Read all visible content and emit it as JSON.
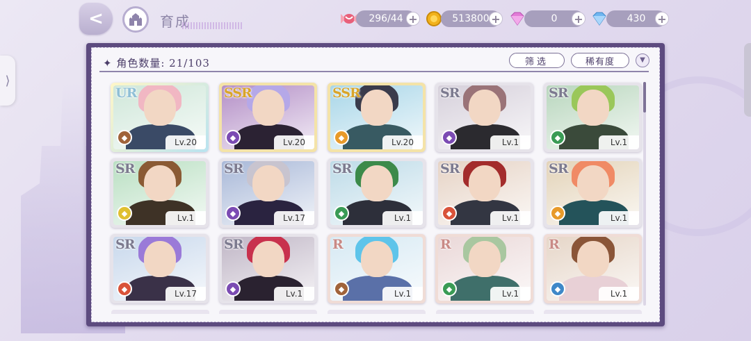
{
  "header": {
    "title": "育成",
    "resources": [
      {
        "name": "candy",
        "value": "296/44",
        "icon": "candy-icon",
        "color": "#e8607a"
      },
      {
        "name": "coin",
        "value": "513800",
        "icon": "coin-icon",
        "color": "#f2b21c"
      },
      {
        "name": "pink-gem",
        "value": "0",
        "icon": "pink-diamond-icon",
        "color": "#e27bd7"
      },
      {
        "name": "blue-gem",
        "value": "430",
        "icon": "blue-diamond-icon",
        "color": "#6fb6f0"
      }
    ],
    "plus_label": "+"
  },
  "panel": {
    "count_label": "✦ 角色数量: 21/103",
    "filter_label": "筛选",
    "rarity_label": "稀有度"
  },
  "characters": [
    {
      "rarity": "UR",
      "level": "Lv.20",
      "role_color": "#a0633a",
      "hair": "#f1b7c3",
      "outfit": "#3a4a66",
      "bg": "#cfe7d9"
    },
    {
      "rarity": "SSR",
      "level": "Lv.20",
      "role_color": "#7b4bb3",
      "hair": "#b5a8e8",
      "outfit": "#2b2233",
      "bg": "#b38ec6"
    },
    {
      "rarity": "SSR",
      "level": "Lv.20",
      "role_color": "#e89a2a",
      "hair": "#3a3b4b",
      "outfit": "#385a62",
      "bg": "#a8d6e8"
    },
    {
      "rarity": "SR",
      "level": "Lv.1",
      "role_color": "#7b4bb3",
      "hair": "#9a7378",
      "outfit": "#2b2a2f",
      "bg": "#d6d0db"
    },
    {
      "rarity": "SR",
      "level": "Lv.1",
      "role_color": "#3a9b55",
      "hair": "#9ac75a",
      "outfit": "#3a4a3a",
      "bg": "#b8d6bd"
    },
    {
      "rarity": "SR",
      "level": "Lv.1",
      "role_color": "#e0c030",
      "hair": "#8a5a34",
      "outfit": "#3e3226",
      "bg": "#b9dfc2"
    },
    {
      "rarity": "SR",
      "level": "Lv.17",
      "role_color": "#7b4bb3",
      "hair": "#c8c4cf",
      "outfit": "#2a2340",
      "bg": "#a8b8d8"
    },
    {
      "rarity": "SR",
      "level": "Lv.1",
      "role_color": "#3a9b55",
      "hair": "#3c8a4a",
      "outfit": "#2d2f3a",
      "bg": "#bddbe8"
    },
    {
      "rarity": "SR",
      "level": "Lv.1",
      "role_color": "#d9533a",
      "hair": "#a32c2c",
      "outfit": "#333642",
      "bg": "#e6d3c5"
    },
    {
      "rarity": "SR",
      "level": "Lv.1",
      "role_color": "#e89a2a",
      "hair": "#f08a65",
      "outfit": "#24535a",
      "bg": "#e3d3b8"
    },
    {
      "rarity": "SR",
      "level": "Lv.17",
      "role_color": "#d9533a",
      "hair": "#9a7ad8",
      "outfit": "#3a3148",
      "bg": "#c8d8ec"
    },
    {
      "rarity": "SR",
      "level": "Lv.1",
      "role_color": "#7b4bb3",
      "hair": "#c8314d",
      "outfit": "#2a2230",
      "bg": "#c0b6c6"
    },
    {
      "rarity": "R",
      "level": "Lv.1",
      "role_color": "#a0633a",
      "hair": "#5ec4ea",
      "outfit": "#5a70a8",
      "bg": "#d6e9f3"
    },
    {
      "rarity": "R",
      "level": "Lv.1",
      "role_color": "#3a9b55",
      "hair": "#a9c7a0",
      "outfit": "#3f6f6a",
      "bg": "#ead8d8"
    },
    {
      "rarity": "R",
      "level": "Lv.1",
      "role_color": "#3f88c8",
      "hair": "#8a5538",
      "outfit": "#e8d0d6",
      "bg": "#e6d6c8"
    }
  ]
}
